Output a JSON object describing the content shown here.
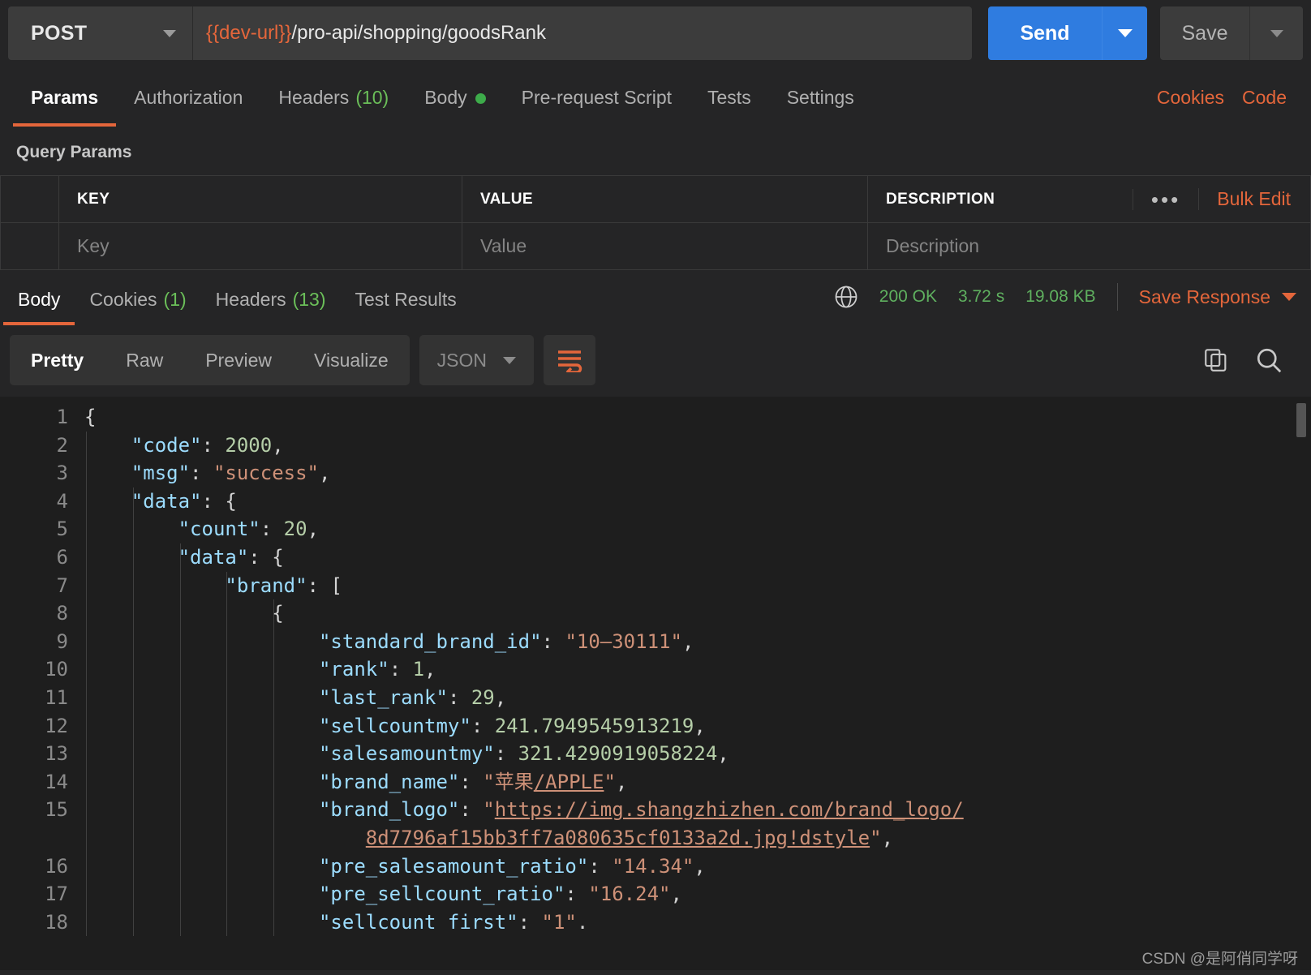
{
  "request": {
    "method": "POST",
    "url_variable": "{{dev-url}}",
    "url_path": "/pro-api/shopping/goodsRank",
    "send_label": "Send",
    "save_label": "Save"
  },
  "request_tabs": [
    {
      "label": "Params",
      "count": "",
      "active": true
    },
    {
      "label": "Authorization",
      "count": "",
      "active": false
    },
    {
      "label": "Headers",
      "count": "(10)",
      "active": false
    },
    {
      "label": "Body",
      "count": "",
      "active": false,
      "dot": true
    },
    {
      "label": "Pre-request Script",
      "count": "",
      "active": false
    },
    {
      "label": "Tests",
      "count": "",
      "active": false
    },
    {
      "label": "Settings",
      "count": "",
      "active": false
    }
  ],
  "request_actions": {
    "cookies": "Cookies",
    "code": "Code"
  },
  "query_params": {
    "title": "Query Params",
    "headers": {
      "key": "KEY",
      "value": "VALUE",
      "description": "DESCRIPTION"
    },
    "bulk_edit": "Bulk Edit",
    "more_options": "•••",
    "placeholders": {
      "key": "Key",
      "value": "Value",
      "description": "Description"
    }
  },
  "response_tabs": [
    {
      "label": "Body",
      "count": "",
      "active": true
    },
    {
      "label": "Cookies",
      "count": "(1)",
      "active": false
    },
    {
      "label": "Headers",
      "count": "(13)",
      "active": false
    },
    {
      "label": "Test Results",
      "count": "",
      "active": false
    }
  ],
  "response_status": {
    "status": "200 OK",
    "time": "3.72 s",
    "size": "19.08 KB",
    "save_response": "Save Response"
  },
  "body_toolbar": {
    "views": [
      "Pretty",
      "Raw",
      "Preview",
      "Visualize"
    ],
    "active_view": "Pretty",
    "format": "JSON"
  },
  "code_lines": [
    {
      "num": "1",
      "indent": 0,
      "tokens": [
        {
          "t": "{",
          "c": "p"
        }
      ]
    },
    {
      "num": "2",
      "indent": 1,
      "tokens": [
        {
          "t": "\"code\"",
          "c": "k"
        },
        {
          "t": ": ",
          "c": "p"
        },
        {
          "t": "2000",
          "c": "n"
        },
        {
          "t": ",",
          "c": "p"
        }
      ]
    },
    {
      "num": "3",
      "indent": 1,
      "tokens": [
        {
          "t": "\"msg\"",
          "c": "k"
        },
        {
          "t": ": ",
          "c": "p"
        },
        {
          "t": "\"success\"",
          "c": "s"
        },
        {
          "t": ",",
          "c": "p"
        }
      ]
    },
    {
      "num": "4",
      "indent": 1,
      "tokens": [
        {
          "t": "\"data\"",
          "c": "k"
        },
        {
          "t": ": {",
          "c": "p"
        }
      ]
    },
    {
      "num": "5",
      "indent": 2,
      "tokens": [
        {
          "t": "\"count\"",
          "c": "k"
        },
        {
          "t": ": ",
          "c": "p"
        },
        {
          "t": "20",
          "c": "n"
        },
        {
          "t": ",",
          "c": "p"
        }
      ]
    },
    {
      "num": "6",
      "indent": 2,
      "tokens": [
        {
          "t": "\"data\"",
          "c": "k"
        },
        {
          "t": ": {",
          "c": "p"
        }
      ]
    },
    {
      "num": "7",
      "indent": 3,
      "tokens": [
        {
          "t": "\"brand\"",
          "c": "k"
        },
        {
          "t": ": [",
          "c": "p"
        }
      ]
    },
    {
      "num": "8",
      "indent": 4,
      "tokens": [
        {
          "t": "{",
          "c": "p"
        }
      ]
    },
    {
      "num": "9",
      "indent": 5,
      "tokens": [
        {
          "t": "\"standard_brand_id\"",
          "c": "k"
        },
        {
          "t": ": ",
          "c": "p"
        },
        {
          "t": "\"10–30111\"",
          "c": "s"
        },
        {
          "t": ",",
          "c": "p"
        }
      ]
    },
    {
      "num": "10",
      "indent": 5,
      "tokens": [
        {
          "t": "\"rank\"",
          "c": "k"
        },
        {
          "t": ": ",
          "c": "p"
        },
        {
          "t": "1",
          "c": "n"
        },
        {
          "t": ",",
          "c": "p"
        }
      ]
    },
    {
      "num": "11",
      "indent": 5,
      "tokens": [
        {
          "t": "\"last_rank\"",
          "c": "k"
        },
        {
          "t": ": ",
          "c": "p"
        },
        {
          "t": "29",
          "c": "n"
        },
        {
          "t": ",",
          "c": "p"
        }
      ]
    },
    {
      "num": "12",
      "indent": 5,
      "tokens": [
        {
          "t": "\"sellcountmy\"",
          "c": "k"
        },
        {
          "t": ": ",
          "c": "p"
        },
        {
          "t": "241.7949545913219",
          "c": "n"
        },
        {
          "t": ",",
          "c": "p"
        }
      ]
    },
    {
      "num": "13",
      "indent": 5,
      "tokens": [
        {
          "t": "\"salesamountmy\"",
          "c": "k"
        },
        {
          "t": ": ",
          "c": "p"
        },
        {
          "t": "321.4290919058224",
          "c": "n"
        },
        {
          "t": ",",
          "c": "p"
        }
      ]
    },
    {
      "num": "14",
      "indent": 5,
      "tokens": [
        {
          "t": "\"brand_name\"",
          "c": "k"
        },
        {
          "t": ": ",
          "c": "p"
        },
        {
          "t": "\"苹果",
          "c": "s"
        },
        {
          "t": "/APPLE",
          "c": "lnk"
        },
        {
          "t": "\"",
          "c": "s"
        },
        {
          "t": ",",
          "c": "p"
        }
      ]
    },
    {
      "num": "15",
      "indent": 5,
      "tokens": [
        {
          "t": "\"brand_logo\"",
          "c": "k"
        },
        {
          "t": ": ",
          "c": "p"
        },
        {
          "t": "\"",
          "c": "s"
        },
        {
          "t": "https://img.shangzhizhen.com/brand_logo/",
          "c": "lnk"
        }
      ]
    },
    {
      "num": "",
      "indent": 6,
      "tokens": [
        {
          "t": "8d7796af15bb3ff7a080635cf0133a2d.jpg!dstyle",
          "c": "lnk"
        },
        {
          "t": "\"",
          "c": "s"
        },
        {
          "t": ",",
          "c": "p"
        }
      ]
    },
    {
      "num": "16",
      "indent": 5,
      "tokens": [
        {
          "t": "\"pre_salesamount_ratio\"",
          "c": "k"
        },
        {
          "t": ": ",
          "c": "p"
        },
        {
          "t": "\"14.34\"",
          "c": "s"
        },
        {
          "t": ",",
          "c": "p"
        }
      ]
    },
    {
      "num": "17",
      "indent": 5,
      "tokens": [
        {
          "t": "\"pre_sellcount_ratio\"",
          "c": "k"
        },
        {
          "t": ": ",
          "c": "p"
        },
        {
          "t": "\"16.24\"",
          "c": "s"
        },
        {
          "t": ",",
          "c": "p"
        }
      ]
    },
    {
      "num": "18",
      "indent": 5,
      "tokens": [
        {
          "t": "\"sellcount first\"",
          "c": "k"
        },
        {
          "t": ": ",
          "c": "p"
        },
        {
          "t": "\"1\"",
          "c": "s"
        },
        {
          "t": ".",
          "c": "p"
        }
      ]
    }
  ],
  "watermark": "CSDN @是阿俏同学呀",
  "colors": {
    "accent": "#e4663b",
    "send": "#2f7ce0",
    "success": "#5fb05f",
    "background": "#252526",
    "editor_background": "#1e1e1e"
  }
}
